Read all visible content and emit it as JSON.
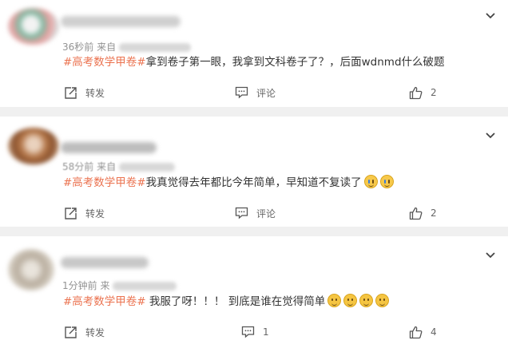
{
  "comments": [
    {
      "time": "36秒前",
      "source_prefix": "来自",
      "hashtag": "#高考数学甲卷#",
      "body": "拿到卷子第一眼，我拿到文科卷子了？，后面wdnmd什么破题",
      "emojis": [],
      "actions": {
        "repost": "转发",
        "comment": "评论",
        "like": "2"
      }
    },
    {
      "time": "58分前",
      "source_prefix": "来自",
      "hashtag": "#高考数学甲卷#",
      "body": "我真觉得去年都比今年简单，早知道不复读了",
      "emojis": [
        "crying-face-icon",
        "crying-face-icon"
      ],
      "actions": {
        "repost": "转发",
        "comment": "评论",
        "like": "2"
      }
    },
    {
      "time": "1分钟前",
      "source_prefix": "来",
      "hashtag": "#高考数学甲卷#",
      "body": " 我服了呀！！！ 到底是谁在觉得简单",
      "emojis": [
        "dizzy-face-icon",
        "dizzy-face-icon",
        "dizzy-face-icon",
        "dizzy-face-icon"
      ],
      "actions": {
        "repost": "转发",
        "comment": "1",
        "like": "4"
      }
    }
  ],
  "colors": {
    "hashtag": "#eb7350",
    "background": "#f0f0f0",
    "card": "#ffffff"
  }
}
